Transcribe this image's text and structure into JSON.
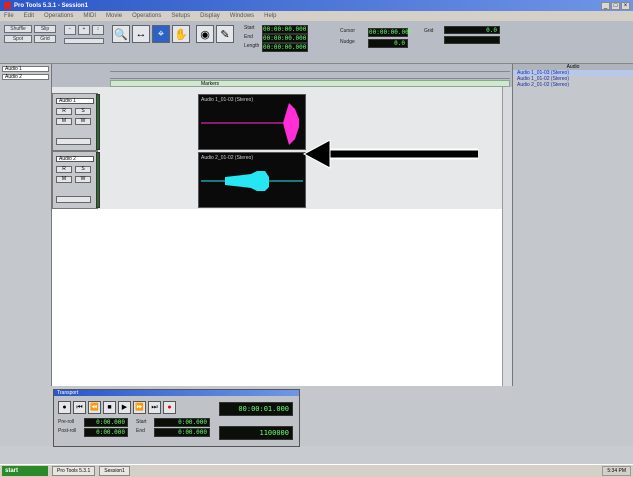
{
  "window": {
    "title": "Pro Tools 5.3.1 - Session1"
  },
  "menu": [
    "File",
    "Edit",
    "Operations",
    "MIDI",
    "Movie",
    "Operations",
    "Setups",
    "Display",
    "Windows",
    "Help"
  ],
  "toolbar": {
    "edit_modes": [
      "Shuffle",
      "Slip",
      "Spot",
      "Grid"
    ],
    "counters": [
      "00:00:00.000",
      "00:00:00.000",
      "00:00:00.000",
      "00:00:00.000",
      "0.0",
      "0.0"
    ],
    "labels": [
      "Start",
      "End",
      "Length",
      "Cursor",
      "Nudge",
      "Grid"
    ]
  },
  "left_list": {
    "items": [
      "Audio 1",
      "Audio 2"
    ]
  },
  "ruler": {
    "marker_label": "Markers"
  },
  "tracks": [
    {
      "name": "Audio 1",
      "region_name": "Audio 1_01-03 (Stereo)",
      "color": "#ff2ed6"
    },
    {
      "name": "Audio 2",
      "region_name": "Audio 2_01-02 (Stereo)",
      "color": "#25e6f2"
    }
  ],
  "regions_list": {
    "header": "Audio",
    "entries": [
      "Audio 1_01-03 (Stereo)",
      "Audio 1_01-02 (Stereo)",
      "Audio 2_01-02 (Stereo)"
    ]
  },
  "transport": {
    "title": "Transport",
    "main_counter": "00:00:01.000",
    "sub_counter": "1100000",
    "labels": [
      "Pre-roll",
      "Post-roll",
      "Start",
      "End"
    ],
    "small_counters": [
      "0:00.000",
      "0:00.000",
      "0:00.000",
      "0:00.000"
    ]
  },
  "taskbar": {
    "start": "start",
    "items": [
      "Pro Tools 5.3.1",
      "Session1"
    ],
    "clock": "5:34 PM"
  },
  "colors": {
    "accent": "#2d62c4",
    "audio1": "#ff2ed6",
    "audio2": "#25e6f2"
  }
}
